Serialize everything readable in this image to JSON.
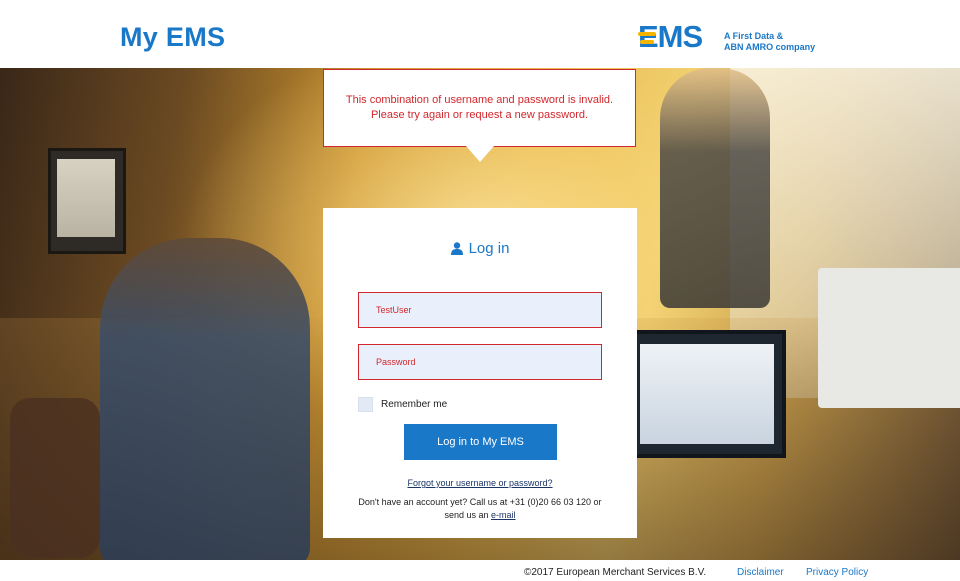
{
  "header": {
    "app_title": "My EMS",
    "brand_logo": "EMS",
    "brand_tag_line1": "A First Data &",
    "brand_tag_line2": "ABN AMRO company"
  },
  "error": {
    "line1": "This combination of username and password is invalid.",
    "line2": "Please try again or request a new password."
  },
  "login": {
    "heading": "Log in",
    "heading_icon": "user-icon",
    "username_value": "TestUser",
    "password_placeholder": "Password",
    "remember_label": "Remember me",
    "button_label": "Log in to My EMS",
    "forgot_link": "Forgot your username or password?",
    "account_text_line1": "Don't have an account yet? Call us at +31 (0)20 66 03 120 or",
    "account_text_line2_prefix": "send us an ",
    "account_email_link": "e-mail"
  },
  "footer": {
    "copyright": "©2017 European Merchant Services B.V.",
    "disclaimer": "Disclaimer",
    "privacy": "Privacy Policy"
  },
  "colors": {
    "brand_blue": "#1a78c8",
    "error_red": "#d0282e",
    "accent_yellow": "#f4b400"
  }
}
